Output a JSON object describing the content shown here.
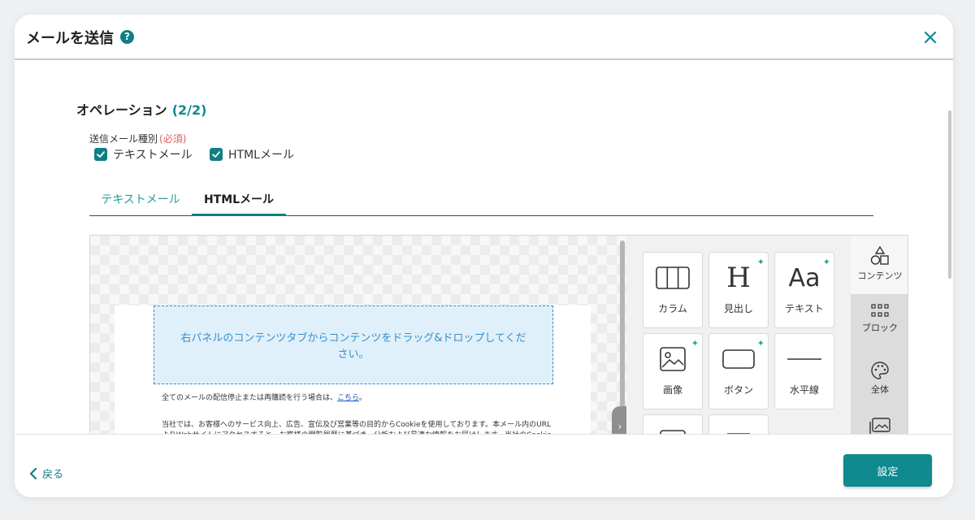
{
  "header": {
    "title": "メールを送信",
    "help_icon": "question-circle-icon",
    "close_icon": "close-icon"
  },
  "section": {
    "title": "オペレーション",
    "step": "(2/2)"
  },
  "mail_type": {
    "label": "送信メール種別",
    "required": "(必須)",
    "options": [
      {
        "label": "テキストメール",
        "checked": true
      },
      {
        "label": "HTMLメール",
        "checked": true
      }
    ]
  },
  "tabs": [
    {
      "label": "テキストメール",
      "active": false
    },
    {
      "label": "HTMLメール",
      "active": true
    }
  ],
  "canvas": {
    "drop_hint": "右パネルのコンテンツタブからコンテンツをドラッグ&ドロップしてください。",
    "unsubscribe_text": "全てのメールの配信停止または再購読を行う場合は、",
    "unsubscribe_link": "こちら",
    "unsubscribe_suffix": "。",
    "notice_text": "当社では、お客様へのサービス向上、広告、宣伝及び営業等の目的からCookieを使用しております。本メール内のURLよりWebサイトにアクセスすると、お客様の閲覧履歴に基づき、分析および最適な情報をお届けします。当社のCookieについての詳細は、プライバシーポリシーをご覧ください。"
  },
  "content_tiles": [
    {
      "label": "カラム",
      "icon": "columns-icon",
      "ai": false
    },
    {
      "label": "見出し",
      "icon": "heading-icon",
      "ai": true,
      "glyph": "H"
    },
    {
      "label": "テキスト",
      "icon": "text-icon",
      "ai": true,
      "glyph": "Aa"
    },
    {
      "label": "画像",
      "icon": "image-icon",
      "ai": true
    },
    {
      "label": "ボタン",
      "icon": "button-icon",
      "ai": true
    },
    {
      "label": "水平線",
      "icon": "divider-icon",
      "ai": false
    },
    {
      "label": "",
      "icon": "html-code-icon",
      "ai": false
    },
    {
      "label": "",
      "icon": "menu-icon",
      "ai": false
    }
  ],
  "side_tabs": [
    {
      "label": "コンテンツ",
      "icon": "shapes-icon",
      "active": true
    },
    {
      "label": "ブロック",
      "icon": "grid-icon",
      "active": false
    },
    {
      "label": "全体",
      "icon": "palette-icon",
      "active": false
    },
    {
      "label": "画像",
      "icon": "images-icon",
      "active": false
    }
  ],
  "footer": {
    "back_label": "戻る",
    "submit_label": "設定"
  },
  "colors": {
    "accent": "#0f8a8f",
    "drop_zone_bg": "#dff0fa",
    "drop_zone_text": "#3b8ec8",
    "required": "#e05a5a"
  }
}
